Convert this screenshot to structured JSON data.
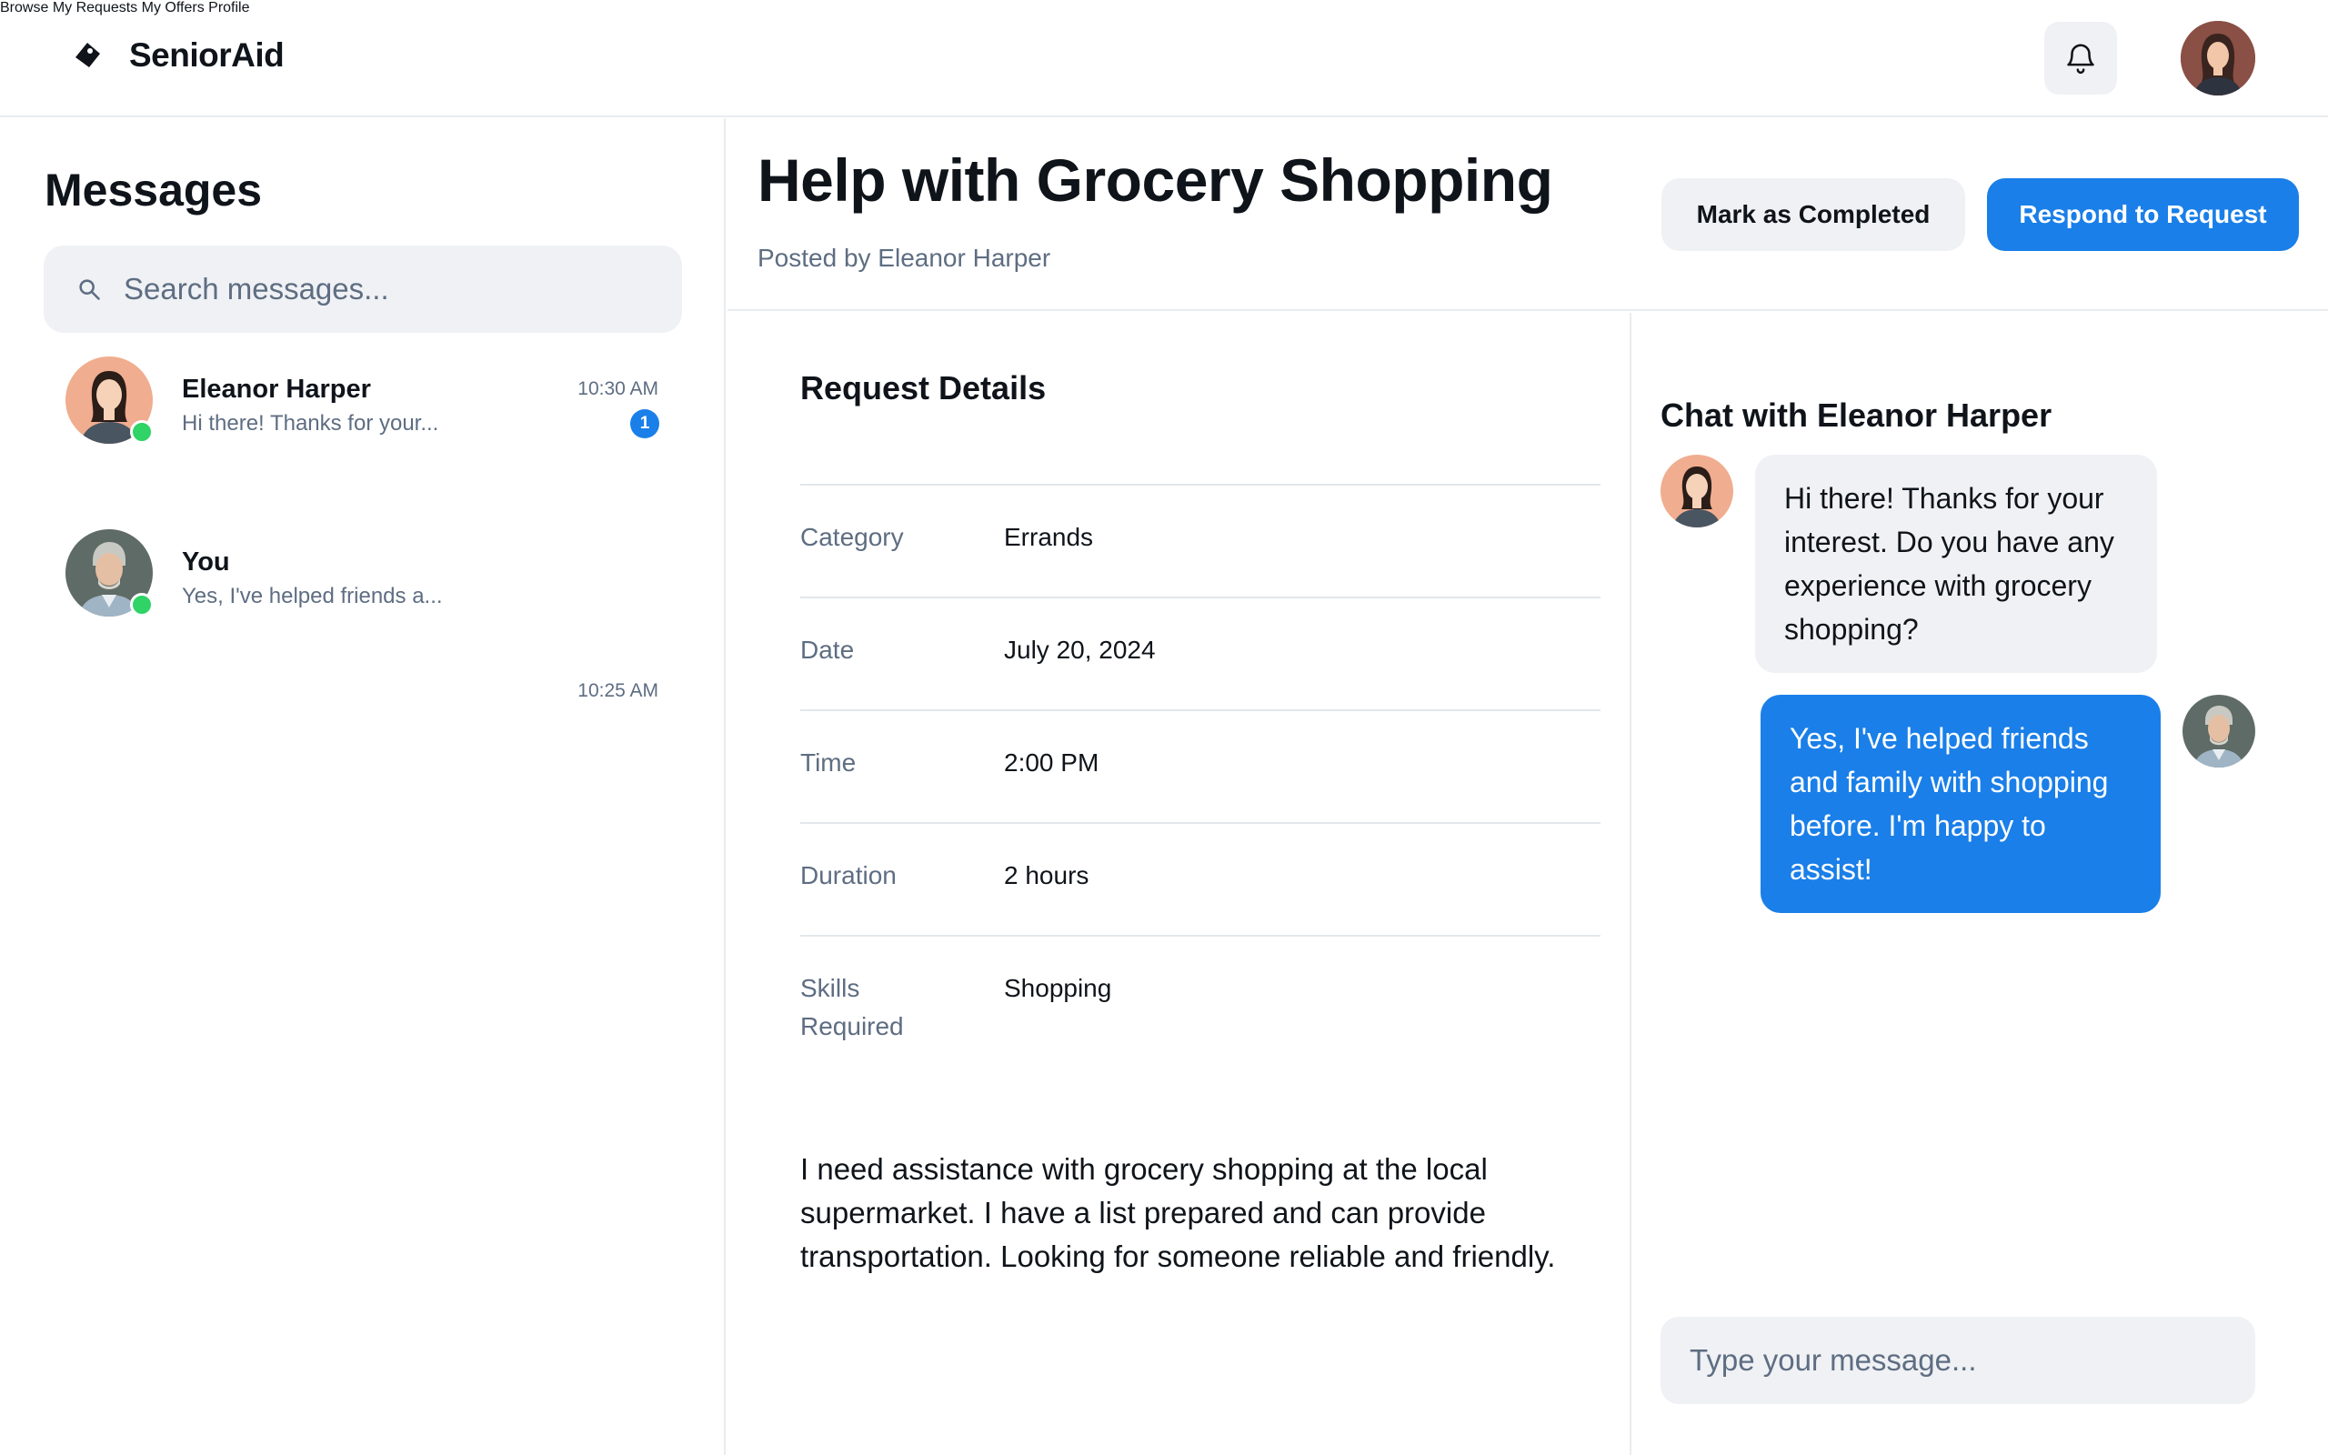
{
  "app": {
    "name": "SeniorAid",
    "logo_icon": "diamond-tag-icon"
  },
  "nav": {
    "items": [
      {
        "label": "Browse"
      },
      {
        "label": "My Requests"
      },
      {
        "label": "My Offers"
      },
      {
        "label": "Profile"
      }
    ],
    "notification_icon": "bell-icon",
    "profile_avatar": "user-avatar"
  },
  "messages": {
    "title": "Messages",
    "search_placeholder": "Search messages...",
    "conversations": [
      {
        "name": "Eleanor Harper",
        "preview": "Hi there! Thanks for your...",
        "time": "10:30 AM",
        "unread": "1",
        "online": true
      },
      {
        "name": "You",
        "preview": "Yes, I've helped friends a...",
        "time": "10:25 AM",
        "online": true
      }
    ]
  },
  "request": {
    "title": "Help with Grocery Shopping",
    "posted_by": "Posted by Eleanor Harper",
    "mark_completed_label": "Mark as Completed",
    "respond_label": "Respond to Request",
    "details_title": "Request Details",
    "details": [
      {
        "label": "Category",
        "value": "Errands"
      },
      {
        "label": "Date",
        "value": "July 20, 2024"
      },
      {
        "label": "Time",
        "value": "2:00 PM"
      },
      {
        "label": "Duration",
        "value": "2 hours"
      },
      {
        "label": "Skills Required",
        "value": "Shopping"
      }
    ],
    "description": "I need assistance with grocery shopping at the local supermarket. I have a list prepared and can provide transportation. Looking for someone reliable and friendly."
  },
  "chat": {
    "title": "Chat with Eleanor Harper",
    "messages": [
      {
        "from": "Eleanor Harper",
        "direction": "incoming",
        "text": "Hi there! Thanks for your interest. Do you have any experience with grocery shopping?"
      },
      {
        "from": "You",
        "direction": "outgoing",
        "text": "Yes, I've helped friends and family with shopping before. I'm happy to assist!"
      }
    ],
    "input_placeholder": "Type your message..."
  },
  "colors": {
    "accent": "#1a7fe8",
    "online": "#2fd366",
    "muted_text": "#5e6d82",
    "surface": "#eff1f4"
  }
}
